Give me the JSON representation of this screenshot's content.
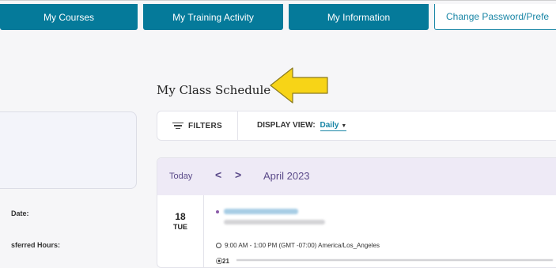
{
  "tabs": [
    {
      "label": "My Courses"
    },
    {
      "label": "My Training Activity"
    },
    {
      "label": "My Information"
    },
    {
      "label": "Change Password/Prefe"
    }
  ],
  "page_title": "My Class Schedule",
  "left_panel": {
    "date_label": "Date:",
    "hours_label": "sferred Hours:"
  },
  "filter_bar": {
    "filters_label": "FILTERS",
    "display_view_label": "DISPLAY VIEW:",
    "display_view_value": "Daily"
  },
  "calendar": {
    "today_label": "Today",
    "prev_label": "<",
    "next_label": ">",
    "month": "April 2023",
    "day_number": "18",
    "day_name": "TUE",
    "event_time": "9:00 AM - 1:00 PM (GMT -07:00) America/Los_Angeles",
    "location_prefix": "21"
  },
  "colors": {
    "tab_bg": "#057a9a",
    "accent": "#1a86a6",
    "calendar_header_bg": "#eeeaf6",
    "calendar_text": "#5b4b8a",
    "arrow": "#f7d417"
  }
}
